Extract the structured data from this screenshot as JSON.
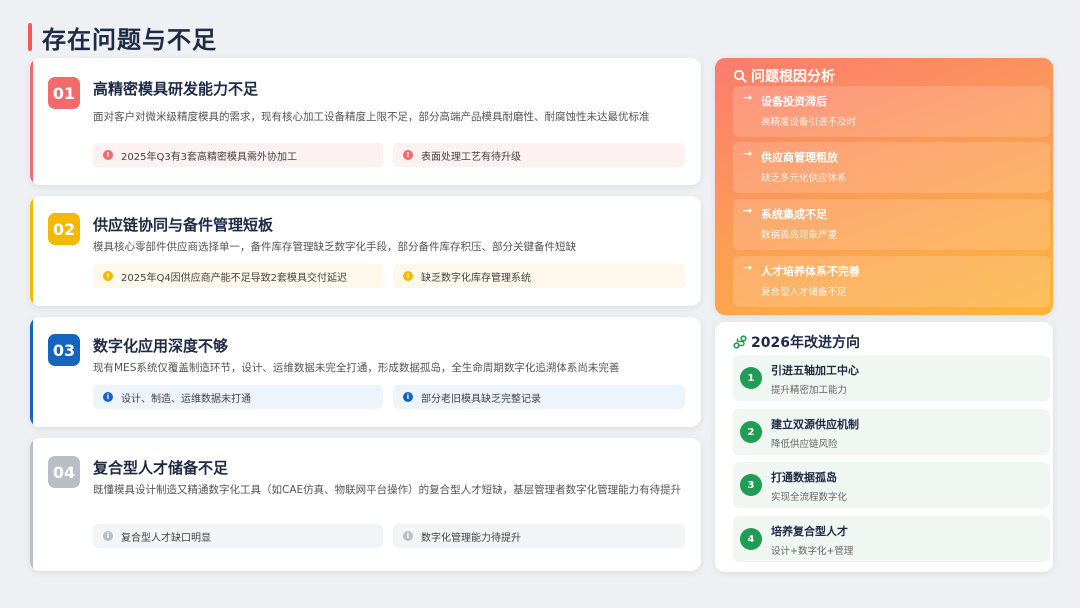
{
  "page": {
    "title": "存在问题与不足"
  },
  "issues": [
    {
      "number": "01",
      "title": "高精密模具研发能力不足",
      "description": "面对客户对微米级精度模具的需求，现有核心加工设备精度上限不足，部分高端产品模具耐磨性、耐腐蚀性未达最优标准",
      "tags": [
        "2025年Q3有3套高精密模具需外协加工",
        "表面处理工艺有待升级"
      ]
    },
    {
      "number": "02",
      "title": "供应链协同与备件管理短板",
      "description": "模具核心零部件供应商选择单一，备件库存管理缺乏数字化手段，部分备件库存积压、部分关键备件短缺",
      "tags": [
        "2025年Q4因供应商产能不足导致2套模具交付延迟",
        "缺乏数字化库存管理系统"
      ]
    },
    {
      "number": "03",
      "title": "数字化应用深度不够",
      "description": "现有MES系统仅覆盖制造环节，设计、运维数据未完全打通，形成数据孤岛，全生命周期数字化追溯体系尚未完善",
      "tags": [
        "设计、制造、运维数据未打通",
        "部分老旧模具缺乏完整记录"
      ]
    },
    {
      "number": "04",
      "title": "复合型人才储备不足",
      "description": "既懂模具设计制造又精通数字化工具（如CAE仿真、物联网平台操作）的复合型人才短缺，基层管理者数字化管理能力有待提升",
      "tags": [
        "复合型人才缺口明显",
        "数字化管理能力待提升"
      ]
    }
  ],
  "root_cause": {
    "title": "问题根因分析",
    "icon": "search-icon",
    "items": [
      {
        "title": "设备投资滞后",
        "sub": "高精度设备引进不及时"
      },
      {
        "title": "供应商管理粗放",
        "sub": "缺乏多元化供应体系"
      },
      {
        "title": "系统集成不足",
        "sub": "数据孤岛现象严重"
      },
      {
        "title": "人才培养体系不完善",
        "sub": "复合型人才储备不足"
      }
    ]
  },
  "improvement": {
    "title": "2026年改进方向",
    "icon": "route-icon",
    "items": [
      {
        "num": "1",
        "title": "引进五轴加工中心",
        "sub": "提升精密加工能力"
      },
      {
        "num": "2",
        "title": "建立双源供应机制",
        "sub": "降低供应链风险"
      },
      {
        "num": "3",
        "title": "打通数据孤岛",
        "sub": "实现全流程数字化"
      },
      {
        "num": "4",
        "title": "培养复合型人才",
        "sub": "设计+数字化+管理"
      }
    ]
  },
  "colors": {
    "issue_1": "#f26b6b",
    "issue_2": "#f5b800",
    "issue_3": "#1565c0",
    "issue_4": "#b9bec7",
    "improvement_green": "#1f9d55"
  }
}
